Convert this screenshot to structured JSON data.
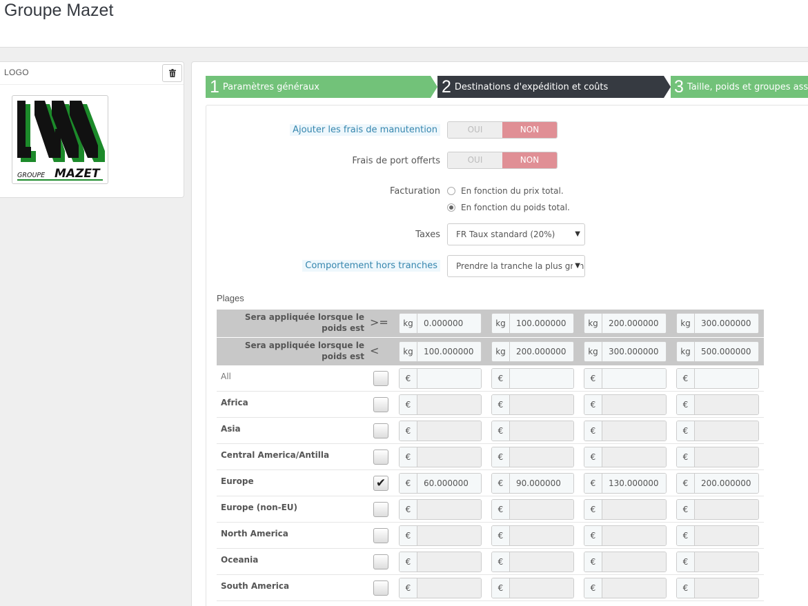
{
  "page": {
    "title": "Groupe Mazet"
  },
  "logo_panel": {
    "title": "LOGO",
    "delete_icon": "trash-icon",
    "logo_text_small": "GROUPE",
    "logo_text_big": "MAZET"
  },
  "wizard": {
    "steps": [
      {
        "num": "1",
        "label": "Paramètres généraux",
        "state": "done"
      },
      {
        "num": "2",
        "label": "Destinations d'expédition et coûts",
        "state": "active"
      },
      {
        "num": "3",
        "label": "Taille, poids et groupes asso",
        "state": "todo"
      }
    ]
  },
  "form": {
    "handling": {
      "label": "Ajouter les frais de manutention",
      "off": "OUI",
      "on": "NON",
      "selected": "NON"
    },
    "free_shipping": {
      "label": "Frais de port offerts",
      "off": "OUI",
      "on": "NON",
      "selected": "NON"
    },
    "billing": {
      "label": "Facturation",
      "options": [
        "En fonction du prix total.",
        "En fonction du poids total."
      ],
      "selected_index": 1
    },
    "taxes": {
      "label": "Taxes",
      "value": "FR Taux standard (20%)"
    },
    "out_of_range": {
      "label": "Comportement hors tranches",
      "value": "Prendre la tranche la plus grande"
    }
  },
  "ranges": {
    "title": "Plages",
    "from": {
      "label": "Sera appliquée lorsque le poids est",
      "op": ">=",
      "unit": "kg",
      "values": [
        "0.000000",
        "100.000000",
        "200.000000",
        "300.000000"
      ]
    },
    "to": {
      "label": "Sera appliquée lorsque le poids est",
      "op": "<",
      "unit": "kg",
      "values": [
        "100.000000",
        "200.000000",
        "300.000000",
        "500.000000"
      ]
    },
    "currency": "€",
    "zones": [
      {
        "name": "All",
        "checked": false,
        "values": [
          "",
          "",
          "",
          ""
        ]
      },
      {
        "name": "Africa",
        "checked": false,
        "values": [
          "",
          "",
          "",
          ""
        ]
      },
      {
        "name": "Asia",
        "checked": false,
        "values": [
          "",
          "",
          "",
          ""
        ]
      },
      {
        "name": "Central America/Antilla",
        "checked": false,
        "values": [
          "",
          "",
          "",
          ""
        ]
      },
      {
        "name": "Europe",
        "checked": true,
        "values": [
          "60.000000",
          "90.000000",
          "130.000000",
          "200.000000"
        ]
      },
      {
        "name": "Europe (non-EU)",
        "checked": false,
        "values": [
          "",
          "",
          "",
          ""
        ]
      },
      {
        "name": "North America",
        "checked": false,
        "values": [
          "",
          "",
          "",
          ""
        ]
      },
      {
        "name": "Oceania",
        "checked": false,
        "values": [
          "",
          "",
          "",
          ""
        ]
      },
      {
        "name": "South America",
        "checked": false,
        "values": [
          "",
          "",
          "",
          ""
        ]
      }
    ]
  },
  "colors": {
    "step_done": "#72c279",
    "step_active": "#363a41",
    "switch_on": "#e08f95",
    "hint_text": "#3586ae"
  }
}
